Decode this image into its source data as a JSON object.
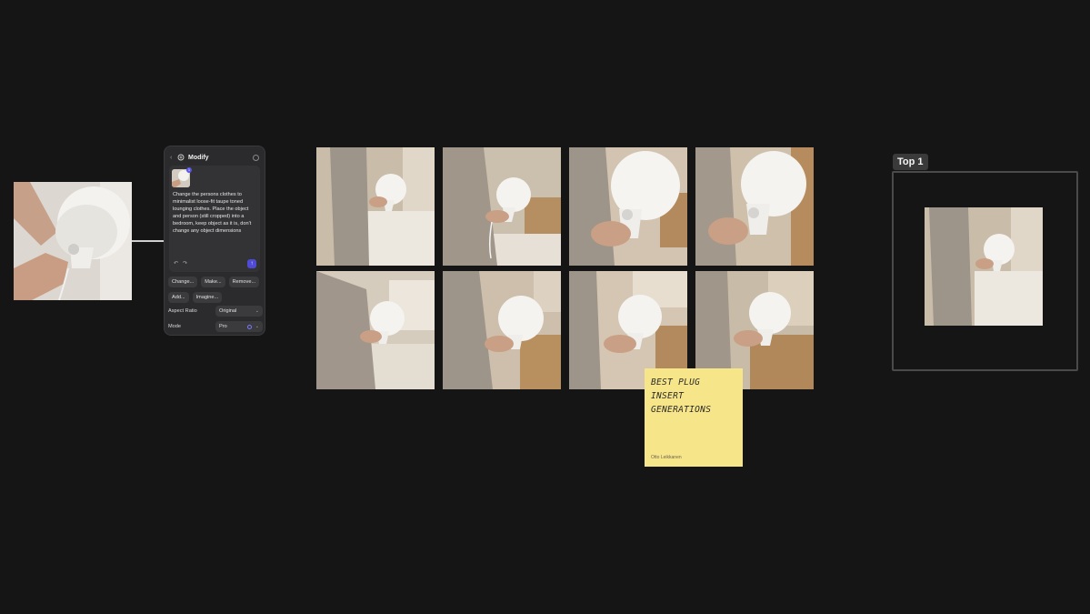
{
  "panel": {
    "title": "Modify",
    "thumb_badge": "1",
    "prompt": "Change the persons clothes to minimalist loose-fit taupe toned lounging clothes. Place the object and person (still cropped) into a bedroom, keep object as it is, don't change any object dimensions",
    "chips": [
      "Change...",
      "Make...",
      "Remove...",
      "Add...",
      "Imagine..."
    ],
    "aspect_ratio": {
      "label": "Aspect Ratio",
      "value": "Original"
    },
    "mode": {
      "label": "Mode",
      "value": "Pro"
    }
  },
  "sticky_note": {
    "title": "BEST PLUG INSERT GENERATIONS",
    "author": "Otto Leikkanen"
  },
  "frame": {
    "tag": "Top 1"
  },
  "colors": {
    "background": "#151515",
    "panel": "#2b2b2d",
    "accent": "#4f4bd6",
    "sticky": "#f7e589"
  },
  "icons": [
    "back-chevron-icon",
    "modify-icon",
    "help-icon",
    "undo-icon",
    "redo-icon",
    "send-icon",
    "chevron-down-icon",
    "mode-dot-icon"
  ]
}
